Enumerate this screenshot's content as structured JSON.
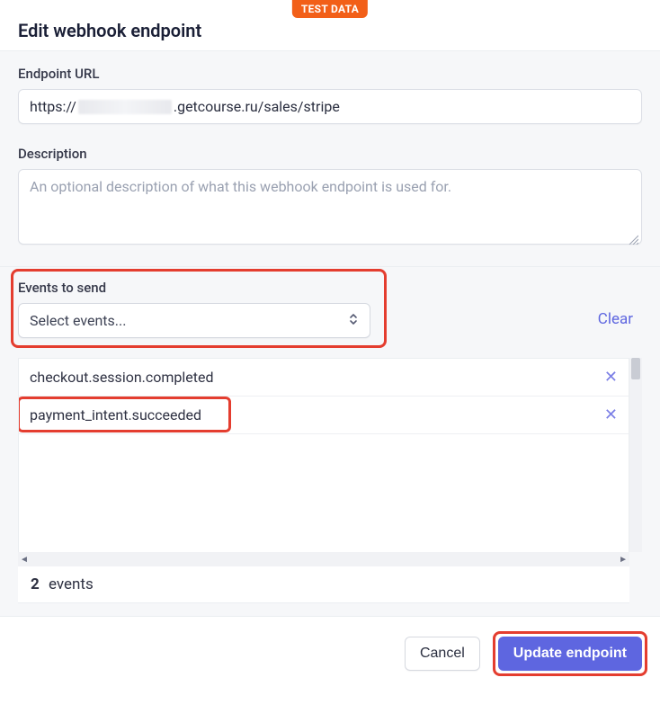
{
  "badge": "TEST DATA",
  "title": "Edit webhook endpoint",
  "url": {
    "label": "Endpoint URL",
    "value_prefix": "https://",
    "value_suffix": ".getcourse.ru/sales/stripe"
  },
  "description": {
    "label": "Description",
    "placeholder": "An optional description of what this webhook endpoint is used for."
  },
  "events": {
    "label": "Events to send",
    "select_placeholder": "Select events...",
    "clear": "Clear",
    "items": [
      {
        "name": "checkout.session.completed"
      },
      {
        "name": "payment_intent.succeeded"
      }
    ],
    "count": "2",
    "count_label": "events"
  },
  "footer": {
    "cancel": "Cancel",
    "update": "Update endpoint"
  }
}
